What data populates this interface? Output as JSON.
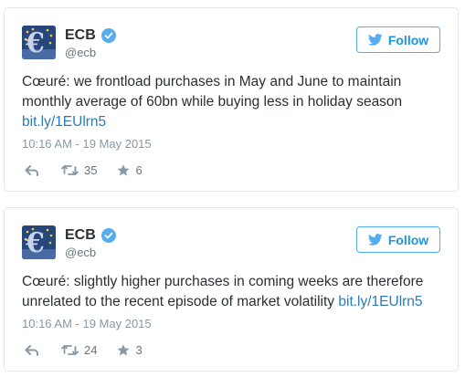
{
  "tweets": [
    {
      "name": "ECB",
      "handle": "@ecb",
      "follow_label": "Follow",
      "text": "Cœuré: we frontload purchases in May and June to maintain monthly average of 60bn while buying less in holiday season",
      "link": "bit.ly/1EUlrn5",
      "timestamp": "10:16 AM - 19 May 2015",
      "retweets": "35",
      "favorites": "6"
    },
    {
      "name": "ECB",
      "handle": "@ecb",
      "follow_label": "Follow",
      "text": "Cœuré: slightly higher purchases in coming weeks are therefore unrelated to the recent episode of market volatility",
      "link": "bit.ly/1EUlrn5",
      "timestamp": "10:16 AM - 19 May 2015",
      "retweets": "24",
      "favorites": "3"
    }
  ],
  "colors": {
    "accent": "#55acee",
    "link": "#2b7bb9",
    "muted": "#8899a6"
  },
  "icons": [
    "verified-badge-icon",
    "twitter-bird-icon",
    "reply-icon",
    "retweet-icon",
    "favorite-star-icon"
  ]
}
